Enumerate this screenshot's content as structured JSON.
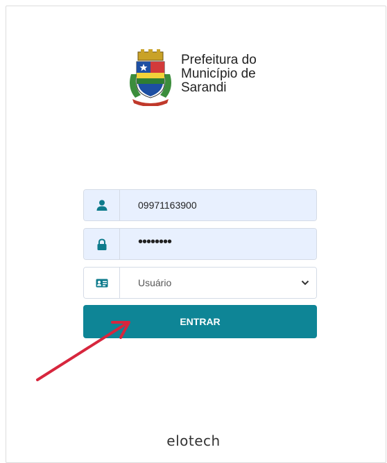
{
  "brand": {
    "line1": "Prefeitura do",
    "line2": "Município de",
    "line3": "Sarandi",
    "crest_icon": "municipal-crest-icon"
  },
  "form": {
    "username": {
      "value": "09971163900",
      "icon": "user-icon"
    },
    "password": {
      "value": "••••••••",
      "icon": "lock-icon"
    },
    "profile": {
      "selected": "Usuário",
      "icon": "id-card-icon"
    },
    "submit_label": "ENTRAR"
  },
  "annotation": {
    "icon": "red-arrow-icon",
    "color": "#d7263d"
  },
  "footer": {
    "logo_text": "elotech"
  },
  "colors": {
    "primary": "#0e8596",
    "field_bg": "#e8f0fe",
    "icon": "#0e7b8c"
  }
}
